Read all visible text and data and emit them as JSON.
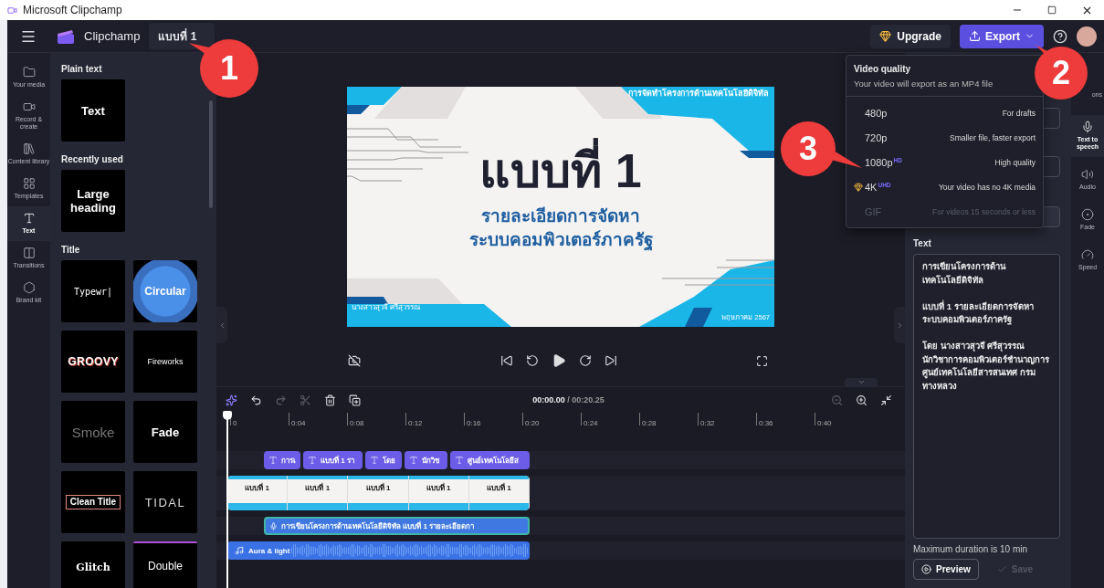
{
  "window": {
    "title": "Microsoft Clipchamp"
  },
  "header": {
    "app_name": "Clipchamp",
    "project_name": "แบบที่ 1",
    "upgrade": "Upgrade",
    "export": "Export"
  },
  "left_nav": [
    {
      "label": "Your media",
      "selected": false
    },
    {
      "label": "Record & create",
      "selected": false
    },
    {
      "label": "Content library",
      "selected": false
    },
    {
      "label": "Templates",
      "selected": false
    },
    {
      "label": "Text",
      "selected": true
    },
    {
      "label": "Transitions",
      "selected": false
    },
    {
      "label": "Brand kit",
      "selected": false
    }
  ],
  "text_panel": {
    "sections": [
      {
        "title": "Plain text",
        "tiles": [
          {
            "label": "Text",
            "kind": "plain"
          }
        ]
      },
      {
        "title": "Recently used",
        "tiles": [
          {
            "label": "Large heading",
            "kind": "plain"
          }
        ]
      },
      {
        "title": "Title",
        "tiles": [
          {
            "label": "Typewr|",
            "kind": "typewriter"
          },
          {
            "label": "Circular",
            "kind": "circular"
          },
          {
            "label": "GROOVY",
            "kind": "groovy"
          },
          {
            "label": "Fireworks",
            "kind": "fireworks"
          },
          {
            "label": "Smoke",
            "kind": "smoke"
          },
          {
            "label": "Fade",
            "kind": "fade"
          },
          {
            "label": "Clean Title",
            "kind": "clean"
          },
          {
            "label": "TIDAL",
            "kind": "tidal"
          },
          {
            "label": "Glitch",
            "kind": "glitch"
          },
          {
            "label": "Double",
            "kind": "double"
          }
        ]
      }
    ]
  },
  "slide": {
    "header": "การจัดทำโครงการด้านเทคโนโลยีดิจิทัล",
    "title": "แบบที่ 1",
    "subtitle_1": "รายละเอียดการจัดหา",
    "subtitle_2": "ระบบคอมพิวเตอร์ภาครัฐ",
    "author": "นางสาวสุวจี ศรีสุวรรณ",
    "date": "พฤษภาคม 2567"
  },
  "timeline": {
    "current_time": "00:00.00",
    "total_time": "/ 00:20.25",
    "ruler": [
      "0",
      "0:04",
      "0:08",
      "0:12",
      "0:16",
      "0:20",
      "0:24",
      "0:28",
      "0:32",
      "0:36",
      "0:40"
    ],
    "text_clips": [
      "การเ",
      "แบบที่ 1 รา",
      "โดย",
      "นักวิช",
      "ศูนย์เทคโนโลยีส"
    ],
    "video_thumbnails": [
      "แบบที่ 1",
      "แบบที่ 1",
      "แบบที่ 1",
      "แบบที่ 1",
      "แบบที่ 1"
    ],
    "voice_clip": "การเขียนโครงการด้านเทคโนโลยีดิจิทัล แบบที่ 1 รายละเอียดกา",
    "audio_clip": "Aura & light"
  },
  "export_menu": {
    "title": "Video quality",
    "subtitle": "Your video will export as an MP4 file",
    "options": [
      {
        "label": "480p",
        "note": "For drafts",
        "premium": false,
        "disabled": false
      },
      {
        "label": "720p",
        "note": "Smaller file, faster export",
        "premium": false,
        "disabled": false
      },
      {
        "label": "1080p",
        "badge": "HD",
        "note": "High quality",
        "premium": false,
        "disabled": false
      },
      {
        "label": "4K",
        "badge": "UHD",
        "note": "Your video has no 4K media",
        "premium": true,
        "disabled": false
      },
      {
        "label": "GIF",
        "note": "For videos 15 seconds or less",
        "premium": false,
        "disabled": true
      }
    ]
  },
  "right_panel": {
    "text_label": "Text",
    "text": "การเขียนโครงการด้าน\nเทคโนโลยีดิจิทัล\n\nแบบที่ 1 รายละเอียดการจัดหา\nระบบคอมพิวเตอร์ภาครัฐ\n\nโดย นางสาวสุวจี ศรีสุวรรณ\nนักวิชาการคอมพิวเตอร์ชำนาญการ\nศูนย์เทคโนโลยีสารสนเทศ กรมทางหลวง",
    "limit": "Maximum duration is 10 min",
    "preview": "Preview",
    "save": "Save",
    "save_disabled": true
  },
  "right_nav": [
    {
      "label": "ons",
      "selected": false
    },
    {
      "label": "Text to speech",
      "selected": true
    },
    {
      "label": "Audio",
      "selected": false
    },
    {
      "label": "Fade",
      "selected": false
    },
    {
      "label": "Speed",
      "selected": false
    }
  ],
  "callouts": [
    "1",
    "2",
    "3"
  ]
}
